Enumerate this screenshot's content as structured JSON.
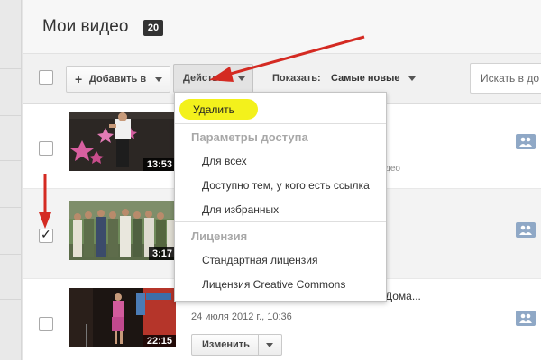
{
  "page": {
    "title": "Мои видео",
    "video_count": "20"
  },
  "toolbar": {
    "add_label": "Добавить в",
    "actions_label": "Действия",
    "show_label": "Показать:",
    "sort_value": "Самые новые",
    "search_placeholder": "Искать в до"
  },
  "actions_menu": {
    "delete": "Удалить",
    "access_header": "Параметры доступа",
    "access_options": [
      "Для всех",
      "Доступно тем, у кого есть ссылка",
      "Для избранных"
    ],
    "license_header": "Лицензия",
    "license_options": [
      "Стандартная лицензия",
      "Лицензия Creative Commons"
    ]
  },
  "videos": [
    {
      "duration": "13:53",
      "meta_tail": "део",
      "checked": false
    },
    {
      "duration": "3:17",
      "checked": true
    },
    {
      "duration": "22:15",
      "title_tail": "Дома...",
      "date": "24 июля 2012 г., 10:36",
      "edit_label": "Изменить",
      "checked": false
    }
  ],
  "annotations": {
    "arrow_color": "#d42a22",
    "highlight_color": "#f3f11c"
  },
  "colors": {
    "badge": "#333333",
    "share_icon": "#8fa8c6"
  },
  "icons": {
    "share": "share-icon",
    "caret": "chevron-down-icon",
    "plus": "plus-icon"
  }
}
